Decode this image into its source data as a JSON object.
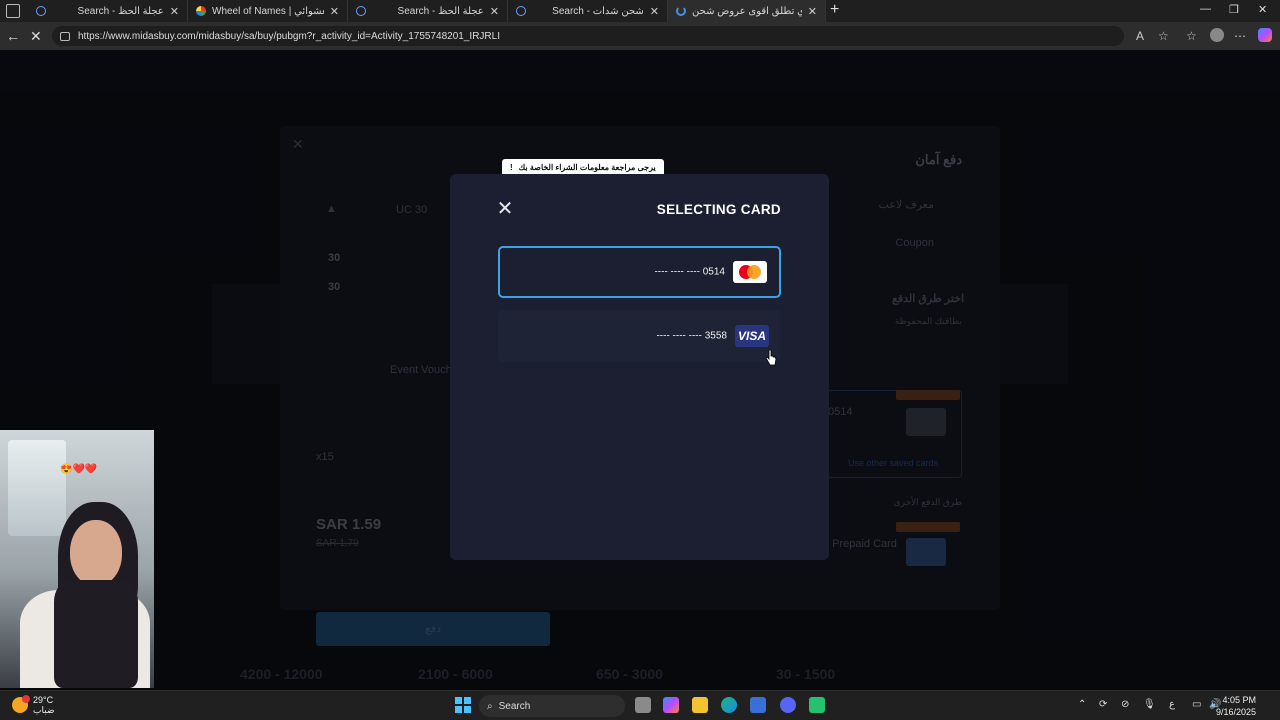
{
  "browser": {
    "tabs": [
      {
        "title": "Search - عجلة الحظ",
        "icon": "search-icon",
        "active": false
      },
      {
        "title": "Wheel of Names | الاسم العشوائي",
        "icon": "wheel-icon",
        "active": false
      },
      {
        "title": "Search - عجلة الحظ",
        "icon": "search-icon",
        "active": false
      },
      {
        "title": "Search - شحن شدات",
        "icon": "search-icon",
        "active": false
      },
      {
        "title": "ميداس باي تطلق أقوى عروض شحن",
        "icon": "loading-icon",
        "active": true
      }
    ],
    "new_tab": "+",
    "url": "https://www.midasbuy.com/midasbuy/sa/buy/pubgm?r_activity_id=Activity_1755748201_IRJRLI"
  },
  "background_page": {
    "checkout_title": "دفع آمان",
    "player_label": "معرف لاعب",
    "coupon_label": "Coupon",
    "product_label": "UC 30",
    "amount_1": "30",
    "amount_2": "30",
    "event_voucher": "Event Voucher",
    "multiplier": "x15",
    "choose_payment": "اختر طرق الدفع",
    "saved_cards": "بطاقتك المحفوظة",
    "saved_card_number": "0514",
    "use_other_cards": "Use other saved cards",
    "other_methods": "طرق الدفع الأخرى",
    "prepaid_card": "/ Prepaid Card",
    "price_now": "SAR 1.59",
    "price_old": "SAR 1.79",
    "pay_button": "دفع",
    "bg_prices": [
      "4200 - 12000",
      "2100 - 6000",
      "650 - 3000",
      "30 - 1500"
    ]
  },
  "tooltip": {
    "text": "يرجى مراجعة معلومات الشراء الخاصة بك",
    "icon": "!"
  },
  "modal": {
    "title": "SELECTING CARD",
    "close": "✕",
    "cards": [
      {
        "masked": "---- ---- ---- 0514",
        "brand": "mastercard",
        "selected": true
      },
      {
        "masked": "---- ---- ---- 3558",
        "brand": "VISA",
        "selected": false
      }
    ]
  },
  "taskbar": {
    "temperature": "29°C",
    "weather_desc": "ضباب",
    "search_label": "Search",
    "time": "4:05 PM",
    "date": "9/16/2025",
    "lang": "ع"
  },
  "colors": {
    "modal_bg": "#1b1f31",
    "selected_border": "#3ba4e6",
    "mastercard_red": "#eb001b",
    "mastercard_yellow": "#f79e1b",
    "visa_blue": "#2a3580"
  }
}
